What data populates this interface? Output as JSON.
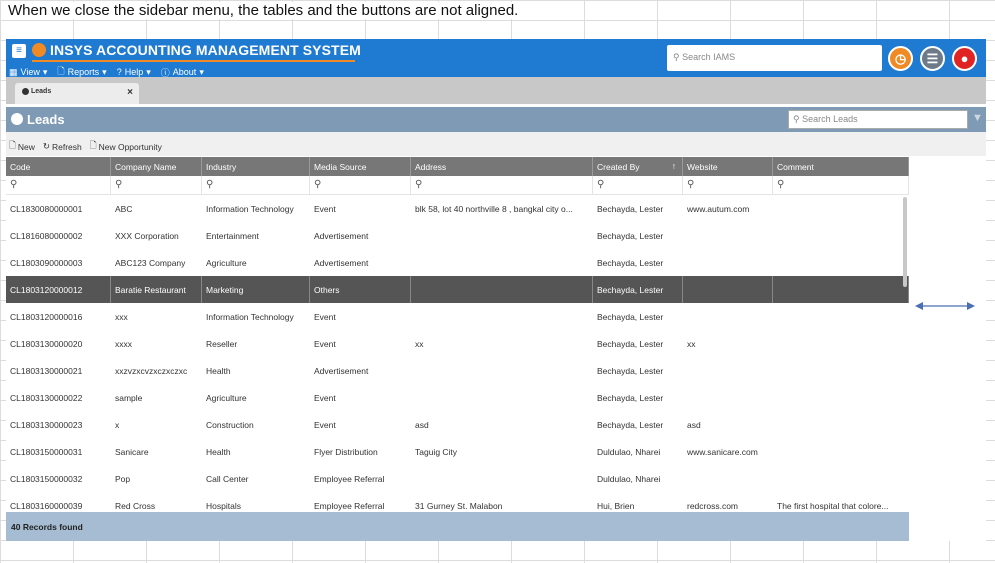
{
  "note": "When we close the sidebar menu, the tables and the buttons are not aligned.",
  "app": {
    "title": "INSYS ACCOUNTING MANAGEMENT SYSTEM",
    "menu": [
      {
        "label": "View",
        "icon": "grid-icon"
      },
      {
        "label": "Reports",
        "icon": "document-icon"
      },
      {
        "label": "Help",
        "icon": "question-icon"
      },
      {
        "label": "About",
        "icon": "info-icon"
      }
    ],
    "search_placeholder": "Search IAMS",
    "accent_color": "#1f7ad1",
    "brand_color": "#f08a24"
  },
  "tab": {
    "label": "Leads",
    "close": "×"
  },
  "header": {
    "title": "Leads",
    "search_placeholder": "Search Leads"
  },
  "toolbar": {
    "new": "New",
    "refresh": "Refresh",
    "new_opportunity": "New Opportunity"
  },
  "columns": [
    "Code",
    "Company Name",
    "Industry",
    "Media Source",
    "Address",
    "Created By",
    "Website",
    "Comment"
  ],
  "sort_indicator": "↑",
  "rows": [
    [
      "CL1830080000001",
      "ABC",
      "Information Technology",
      "Event",
      "blk 58, lot 40 northville 8 , bangkal city o...",
      "Bechayda, Lester",
      "www.autum.com",
      ""
    ],
    [
      "CL1816080000002",
      "XXX Corporation",
      "Entertainment",
      "Advertisement",
      "",
      "Bechayda, Lester",
      "",
      ""
    ],
    [
      "CL1803090000003",
      "ABC123 Company",
      "Agriculture",
      "Advertisement",
      "",
      "Bechayda, Lester",
      "",
      ""
    ],
    [
      "CL1803120000012",
      "Baratie Restaurant",
      "Marketing",
      "Others",
      "",
      "Bechayda, Lester",
      "",
      ""
    ],
    [
      "CL1803120000016",
      "xxx",
      "Information Technology",
      "Event",
      "",
      "Bechayda, Lester",
      "",
      ""
    ],
    [
      "CL1803130000020",
      "xxxx",
      "Reseller",
      "Event",
      "xx",
      "Bechayda, Lester",
      "xx",
      ""
    ],
    [
      "CL1803130000021",
      "xxzvzxcvzxczxczxc",
      "Health",
      "Advertisement",
      "",
      "Bechayda, Lester",
      "",
      ""
    ],
    [
      "CL1803130000022",
      "sample",
      "Agriculture",
      "Event",
      "",
      "Bechayda, Lester",
      "",
      ""
    ],
    [
      "CL1803130000023",
      "x",
      "Construction",
      "Event",
      "asd",
      "Bechayda, Lester",
      "asd",
      ""
    ],
    [
      "CL1803150000031",
      "Sanicare",
      "Health",
      "Flyer Distribution",
      "Taguig City",
      "Duldulao, Nharei",
      "www.sanicare.com",
      ""
    ],
    [
      "CL1803150000032",
      "Pop",
      "Call Center",
      "Employee Referral",
      "",
      "Duldulao, Nharei",
      "",
      ""
    ],
    [
      "CL1803160000039",
      "Red Cross",
      "Hospitals",
      "Employee Referral",
      "31 Gurney St. Malabon",
      "Hui, Brien",
      "redcross.com",
      "The first hospital that colore..."
    ]
  ],
  "selected_row": 3,
  "footer": "40 Records found"
}
